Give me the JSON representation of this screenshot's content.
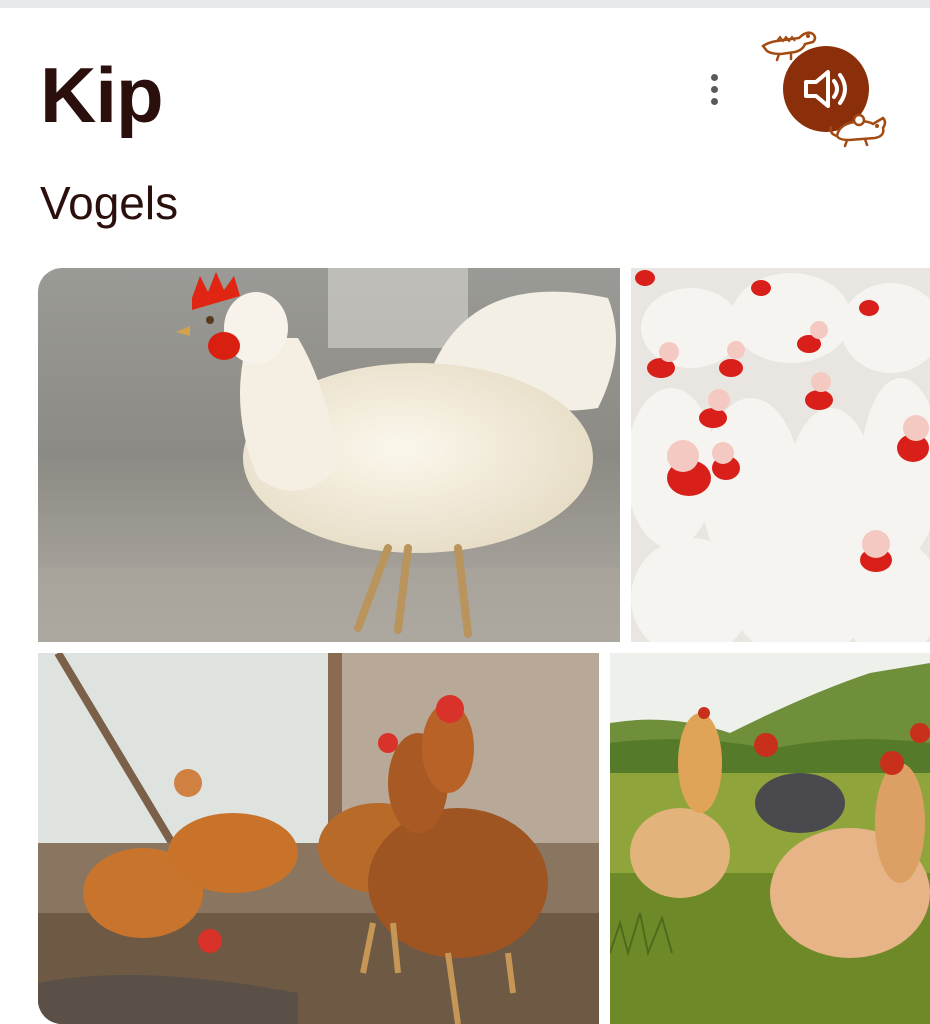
{
  "header": {
    "title": "Kip",
    "category": "Vogels",
    "more_icon": "more-vert-icon",
    "sound_icon": "speaker-icon"
  },
  "colors": {
    "title_text": "#2b0f0c",
    "sound_button": "#8a2f0a",
    "decoration": "#a34a12"
  },
  "gallery": [
    {
      "icon": "white-hen-photo"
    },
    {
      "icon": "white-chicken-flock-photo"
    },
    {
      "icon": "brown-hens-farmyard-photo"
    },
    {
      "icon": "hens-in-meadow-photo"
    }
  ]
}
